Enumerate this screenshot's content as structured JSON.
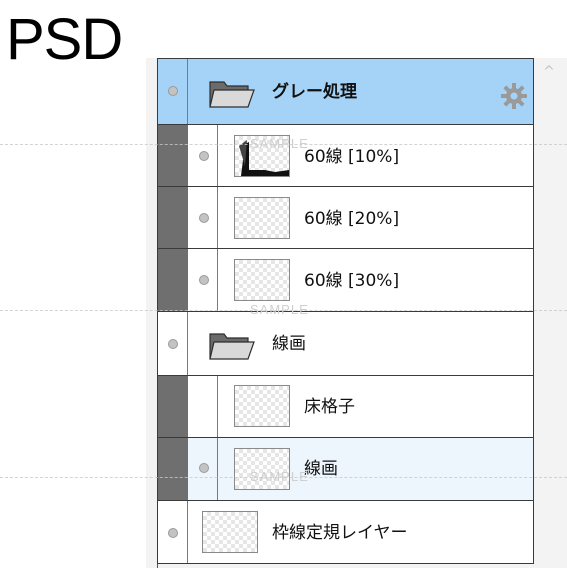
{
  "header": {
    "title": "PSD"
  },
  "watermark": "SAMPLE",
  "layers": [
    {
      "name": "グレー処理",
      "kind": "folder",
      "selected": true,
      "icon": "folder-open-icon",
      "settings_icon": "gear-icon"
    },
    {
      "name": "60線 [10%]",
      "kind": "layer",
      "clipped": true,
      "icon": "layer-thumbnail"
    },
    {
      "name": "60線 [20%]",
      "kind": "layer",
      "clipped": true,
      "icon": "layer-thumbnail"
    },
    {
      "name": "60線 [30%]",
      "kind": "layer",
      "clipped": true,
      "icon": "layer-thumbnail"
    },
    {
      "name": "線画",
      "kind": "folder",
      "icon": "folder-open-icon"
    },
    {
      "name": "床格子",
      "kind": "layer",
      "hidden": true,
      "icon": "layer-thumbnail"
    },
    {
      "name": "線画",
      "kind": "layer",
      "hover": true,
      "icon": "layer-thumbnail"
    },
    {
      "name": "枠線定規レイヤー",
      "kind": "layer",
      "icon": "layer-thumbnail"
    }
  ],
  "colors": {
    "selected_row": "#a5d3f7",
    "hover_row": "#eef6fd",
    "clip_strip": "#6f6f6f",
    "gear": "#9a9a9a"
  }
}
